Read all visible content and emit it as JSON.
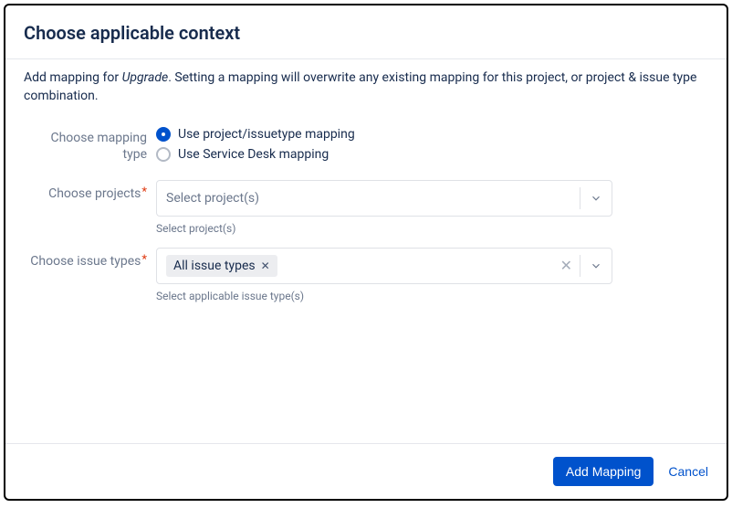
{
  "header": {
    "title": "Choose applicable context"
  },
  "intro": {
    "prefix": "Add mapping for ",
    "scheme": "Upgrade",
    "suffix": ". Setting a mapping will overwrite any existing mapping for this project, or project & issue type combination."
  },
  "fields": {
    "mappingType": {
      "label": "Choose mapping type",
      "options": [
        {
          "label": "Use project/issuetype mapping",
          "selected": true
        },
        {
          "label": "Use Service Desk mapping",
          "selected": false
        }
      ]
    },
    "projects": {
      "label": "Choose projects",
      "placeholder": "Select project(s)",
      "helper": "Select project(s)"
    },
    "issueTypes": {
      "label": "Choose issue types",
      "chip": "All issue types",
      "helper": "Select applicable issue type(s)"
    }
  },
  "footer": {
    "primary": "Add Mapping",
    "cancel": "Cancel"
  }
}
